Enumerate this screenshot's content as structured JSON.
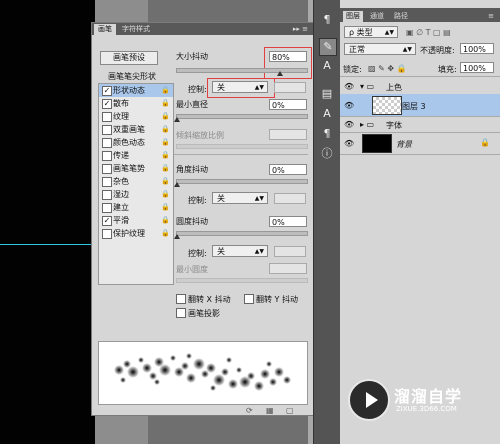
{
  "brush_panel": {
    "tabs": [
      "画笔",
      "字符样式"
    ],
    "preset_button": "画笔预设",
    "options_header": "画笔笔尖形状",
    "options": [
      {
        "label": "形状动态",
        "checked": true,
        "highlighted": true
      },
      {
        "label": "散布",
        "checked": true
      },
      {
        "label": "纹理",
        "checked": false
      },
      {
        "label": "双重画笔",
        "checked": false
      },
      {
        "label": "颜色动态",
        "checked": false
      },
      {
        "label": "传递",
        "checked": false
      },
      {
        "label": "画笔笔势",
        "checked": false
      },
      {
        "label": "杂色",
        "checked": false
      },
      {
        "label": "湿边",
        "checked": false
      },
      {
        "label": "建立",
        "checked": false
      },
      {
        "label": "平滑",
        "checked": true
      },
      {
        "label": "保护纹理",
        "checked": false
      }
    ],
    "size_jitter_label": "大小抖动",
    "size_jitter_value": "80%",
    "control_label": "控制:",
    "control_value": "关",
    "min_diameter_label": "最小直径",
    "min_diameter_value": "0%",
    "tilt_scale_label": "倾斜缩放比例",
    "angle_jitter_label": "角度抖动",
    "angle_jitter_value": "0%",
    "angle_control_label": "控制:",
    "angle_control_value": "关",
    "roundness_jitter_label": "圆度抖动",
    "roundness_jitter_value": "0%",
    "roundness_control_label": "控制:",
    "roundness_control_value": "关",
    "min_roundness_label": "最小圆度",
    "flip_x_label": "翻转 X 抖动",
    "flip_y_label": "翻转 Y 抖动",
    "brush_projection_label": "画笔投影"
  },
  "layers_panel": {
    "tabs": [
      "图层",
      "通道",
      "路径"
    ],
    "filter_type": "ρ 类型",
    "blend_mode": "正常",
    "opacity_label": "不透明度:",
    "opacity_value": "100%",
    "lock_label": "锁定:",
    "fill_label": "填充:",
    "fill_value": "100%",
    "layers": [
      {
        "name": "上色",
        "kind": "group"
      },
      {
        "name": "图层 3",
        "kind": "layer",
        "selected": true
      },
      {
        "name": "字体",
        "kind": "group"
      },
      {
        "name": "背景",
        "kind": "background"
      }
    ]
  },
  "watermark": {
    "title": "溜溜自学",
    "url": "ZIXUE.3D66.COM"
  }
}
